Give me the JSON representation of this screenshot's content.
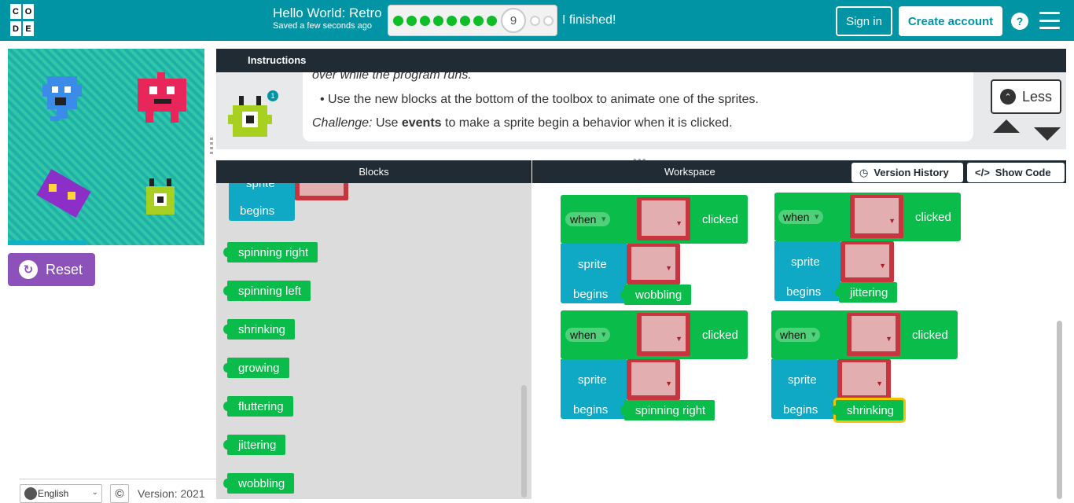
{
  "header": {
    "logo_letters": [
      "C",
      "O",
      "",
      "D",
      "E",
      ""
    ],
    "title": "Hello World: Retro",
    "saved": "Saved a few seconds ago",
    "progress": {
      "completed": 8,
      "current": "9",
      "remaining": 2
    },
    "finished": "I finished!",
    "sign_in": "Sign in",
    "create_account": "Create account",
    "help": "?"
  },
  "reset_label": "Reset",
  "instructions": {
    "header": "Instructions",
    "line1": "over while the program runs.",
    "line2": "• Use the new blocks at the bottom of the toolbox to animate one of the sprites.",
    "line3_prefix": "Challenge:",
    "line3_mid1": " Use ",
    "line3_bold": "events",
    "line3_suffix": " to make a sprite begin a behavior when it is clicked.",
    "badge": "1",
    "less": "Less"
  },
  "blocks_header": "Blocks",
  "workspace_header": "Workspace",
  "version_history": "Version History",
  "show_code": "Show Code",
  "toolbox": {
    "partial_sprite": "sprite",
    "partial_begins": "begins",
    "items": [
      "spinning right",
      "spinning left",
      "shrinking",
      "growing",
      "fluttering",
      "jittering",
      "wobbling"
    ]
  },
  "workspace": {
    "when": "when",
    "clicked": "clicked",
    "sprite": "sprite",
    "begins": "begins",
    "groups": [
      {
        "behavior": "wobbling",
        "sprite_color": "#3b8be8"
      },
      {
        "behavior": "jittering",
        "sprite_color": "#e8265a"
      },
      {
        "behavior": "spinning right",
        "sprite_color": "#8c2fc8"
      },
      {
        "behavior": "shrinking",
        "sprite_color": "#a8d020"
      }
    ]
  },
  "footer": {
    "language": "English",
    "copyright": "©",
    "version": "Version: 2021"
  },
  "colors": {
    "topbar": "#0094a5",
    "event_green": "#0abc4a",
    "sprite_cyan": "#0fa8c5",
    "reset_purple": "#8c52ba"
  }
}
